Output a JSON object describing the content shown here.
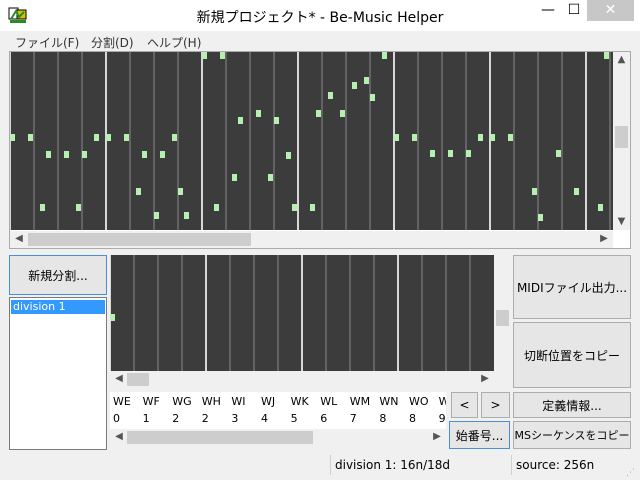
{
  "window": {
    "title": "新規プロジェクト* - Be-Music Helper",
    "minimize_glyph": "—",
    "maximize_glyph": "☐",
    "close_glyph": "✕"
  },
  "menu": [
    "ファイル(F)",
    "分割(D)",
    "ヘルプ(H)"
  ],
  "buttons": {
    "new_division": "新規分割...",
    "midi_export": "MIDIファイル出力...",
    "copy_cut_positions": "切断位置をコピー",
    "prev": "<",
    "next": ">",
    "definition_info": "定義情報...",
    "start_number": "始番号...",
    "copy_ms_sequence": "MSシーケンスをコピー"
  },
  "divisions": [
    "division 1"
  ],
  "channel_table": {
    "headers": [
      "WE",
      "WF",
      "WG",
      "WH",
      "WI",
      "WJ",
      "WK",
      "WL",
      "WM",
      "WN",
      "WO",
      "W"
    ],
    "values": [
      "0",
      "1",
      "2",
      "2",
      "3",
      "4",
      "5",
      "6",
      "7",
      "8",
      "8",
      "9"
    ]
  },
  "status": {
    "division_info": "division 1: 16n/18d",
    "source_info": "source: 256n"
  },
  "icons": {
    "scroll_left": "chevron-left-icon",
    "scroll_right": "chevron-right-icon",
    "scroll_up": "chevron-up-icon",
    "scroll_down": "chevron-down-icon"
  },
  "colors": {
    "note": "#b6f0b0",
    "editor_background": "#3c3c3c",
    "selection": "#3399ff",
    "close_button": "#c7c7c7"
  }
}
